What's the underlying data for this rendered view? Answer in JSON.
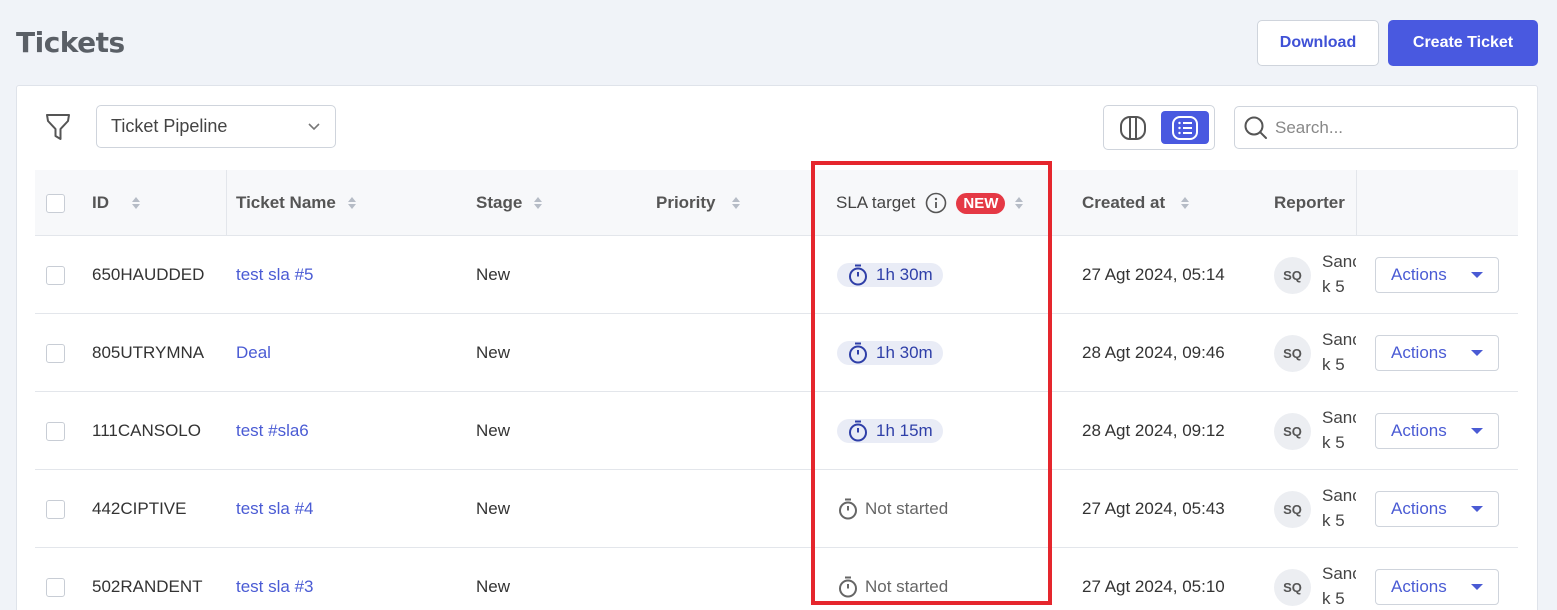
{
  "header": {
    "title": "Tickets",
    "download_label": "Download",
    "create_label": "Create Ticket"
  },
  "toolbar": {
    "pipeline_value": "Ticket Pipeline",
    "search_placeholder": "Search..."
  },
  "table": {
    "columns": {
      "id": "ID",
      "name": "Ticket Name",
      "stage": "Stage",
      "priority": "Priority",
      "sla": "SLA target",
      "sla_badge": "NEW",
      "created": "Created at",
      "reporter": "Reporter"
    },
    "rows": [
      {
        "id": "650HAUDDED",
        "name": "test sla #5",
        "stage": "New",
        "priority": "",
        "sla": "1h 30m",
        "sla_active": true,
        "created": "27 Agt 2024, 05:14",
        "avatar": "SQ",
        "reporter_l1": "Sanc",
        "reporter_l2": "k 5",
        "actions": "Actions"
      },
      {
        "id": "805UTRYMNA",
        "name": "Deal",
        "stage": "New",
        "priority": "",
        "sla": "1h 30m",
        "sla_active": true,
        "created": "28 Agt 2024, 09:46",
        "avatar": "SQ",
        "reporter_l1": "Sanc",
        "reporter_l2": "k 5",
        "actions": "Actions"
      },
      {
        "id": "111CANSOLO",
        "name": "test #sla6",
        "stage": "New",
        "priority": "",
        "sla": "1h 15m",
        "sla_active": true,
        "created": "28 Agt 2024, 09:12",
        "avatar": "SQ",
        "reporter_l1": "Sanc",
        "reporter_l2": "k 5",
        "actions": "Actions"
      },
      {
        "id": "442CIPTIVE",
        "name": "test sla #4",
        "stage": "New",
        "priority": "",
        "sla": "Not started",
        "sla_active": false,
        "created": "27 Agt 2024, 05:43",
        "avatar": "SQ",
        "reporter_l1": "Sanc",
        "reporter_l2": "k 5",
        "actions": "Actions"
      },
      {
        "id": "502RANDENT",
        "name": "test sla #3",
        "stage": "New",
        "priority": "",
        "sla": "Not started",
        "sla_active": false,
        "created": "27 Agt 2024, 05:10",
        "avatar": "SQ",
        "reporter_l1": "Sanc",
        "reporter_l2": "k 5",
        "actions": "Actions"
      }
    ]
  },
  "colors": {
    "primary": "#4959e0",
    "link": "#4a5bd4",
    "highlight": "#e5262d",
    "new_badge": "#e53945"
  }
}
